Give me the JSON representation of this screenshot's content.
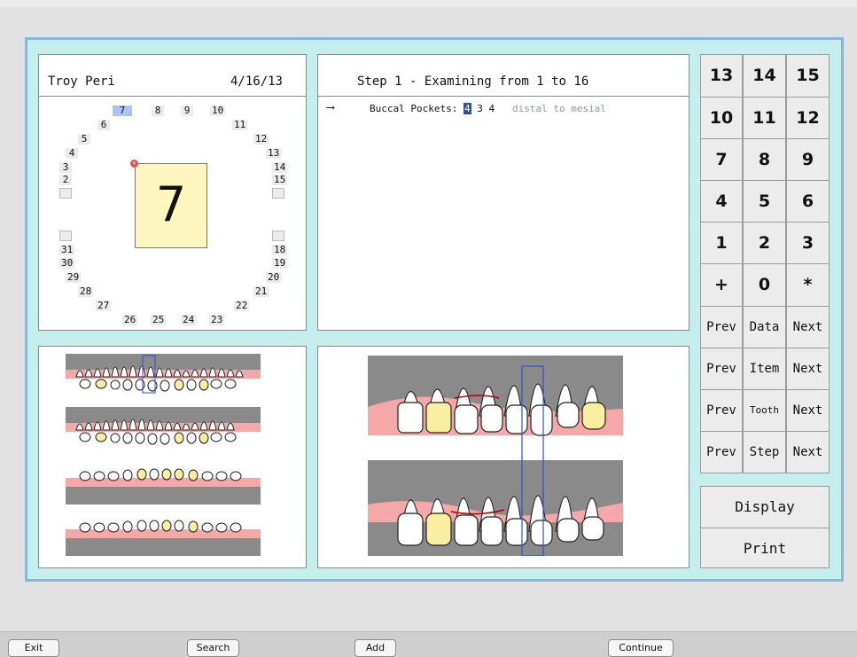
{
  "patient": {
    "name": "Troy Peri",
    "date": "4/16/13",
    "current_tooth": "7"
  },
  "chart_numbers": {
    "upper_row": [
      "7",
      "8",
      "9",
      "10"
    ],
    "left_upper": [
      "6",
      "5",
      "4",
      "3",
      "2"
    ],
    "right_upper": [
      "11",
      "12",
      "13",
      "14",
      "15"
    ],
    "left_lower": [
      "31",
      "30",
      "29",
      "28",
      "27"
    ],
    "right_lower": [
      "18",
      "19",
      "20",
      "21",
      "22"
    ],
    "lower_row": [
      "26",
      "25",
      "24",
      "23"
    ]
  },
  "step": {
    "title": "Step 1 - Examining from 1 to 16",
    "arrow": "⟶",
    "label": "Buccal Pockets:",
    "cursor_value": "4",
    "value_2": "3",
    "value_3": "4",
    "hint": "distal to mesial"
  },
  "keypad": {
    "keys": [
      "13",
      "14",
      "15",
      "10",
      "11",
      "12",
      "7",
      "8",
      "9",
      "4",
      "5",
      "6",
      "1",
      "2",
      "3",
      "+",
      "0",
      "*"
    ],
    "nav_rows": [
      {
        "prev": "Prev",
        "label": "Data",
        "next": "Next"
      },
      {
        "prev": "Prev",
        "label": "Item",
        "next": "Next"
      },
      {
        "prev": "Prev",
        "label": "Tooth",
        "next": "Next"
      },
      {
        "prev": "Prev",
        "label": "Step",
        "next": "Next"
      }
    ],
    "display": "Display",
    "print": "Print"
  },
  "bottom": {
    "exit": "Exit",
    "search": "Search",
    "add": "Add",
    "continue": "Continue"
  },
  "colors": {
    "frame_bg": "#c4efec",
    "frame_border": "#86b6e2",
    "gum_pink": "#f4a8a8",
    "gum_gray": "#8a8a8a",
    "tooth_yellow": "#f8f0a0",
    "highlight_blue": "#2c4fd0"
  }
}
